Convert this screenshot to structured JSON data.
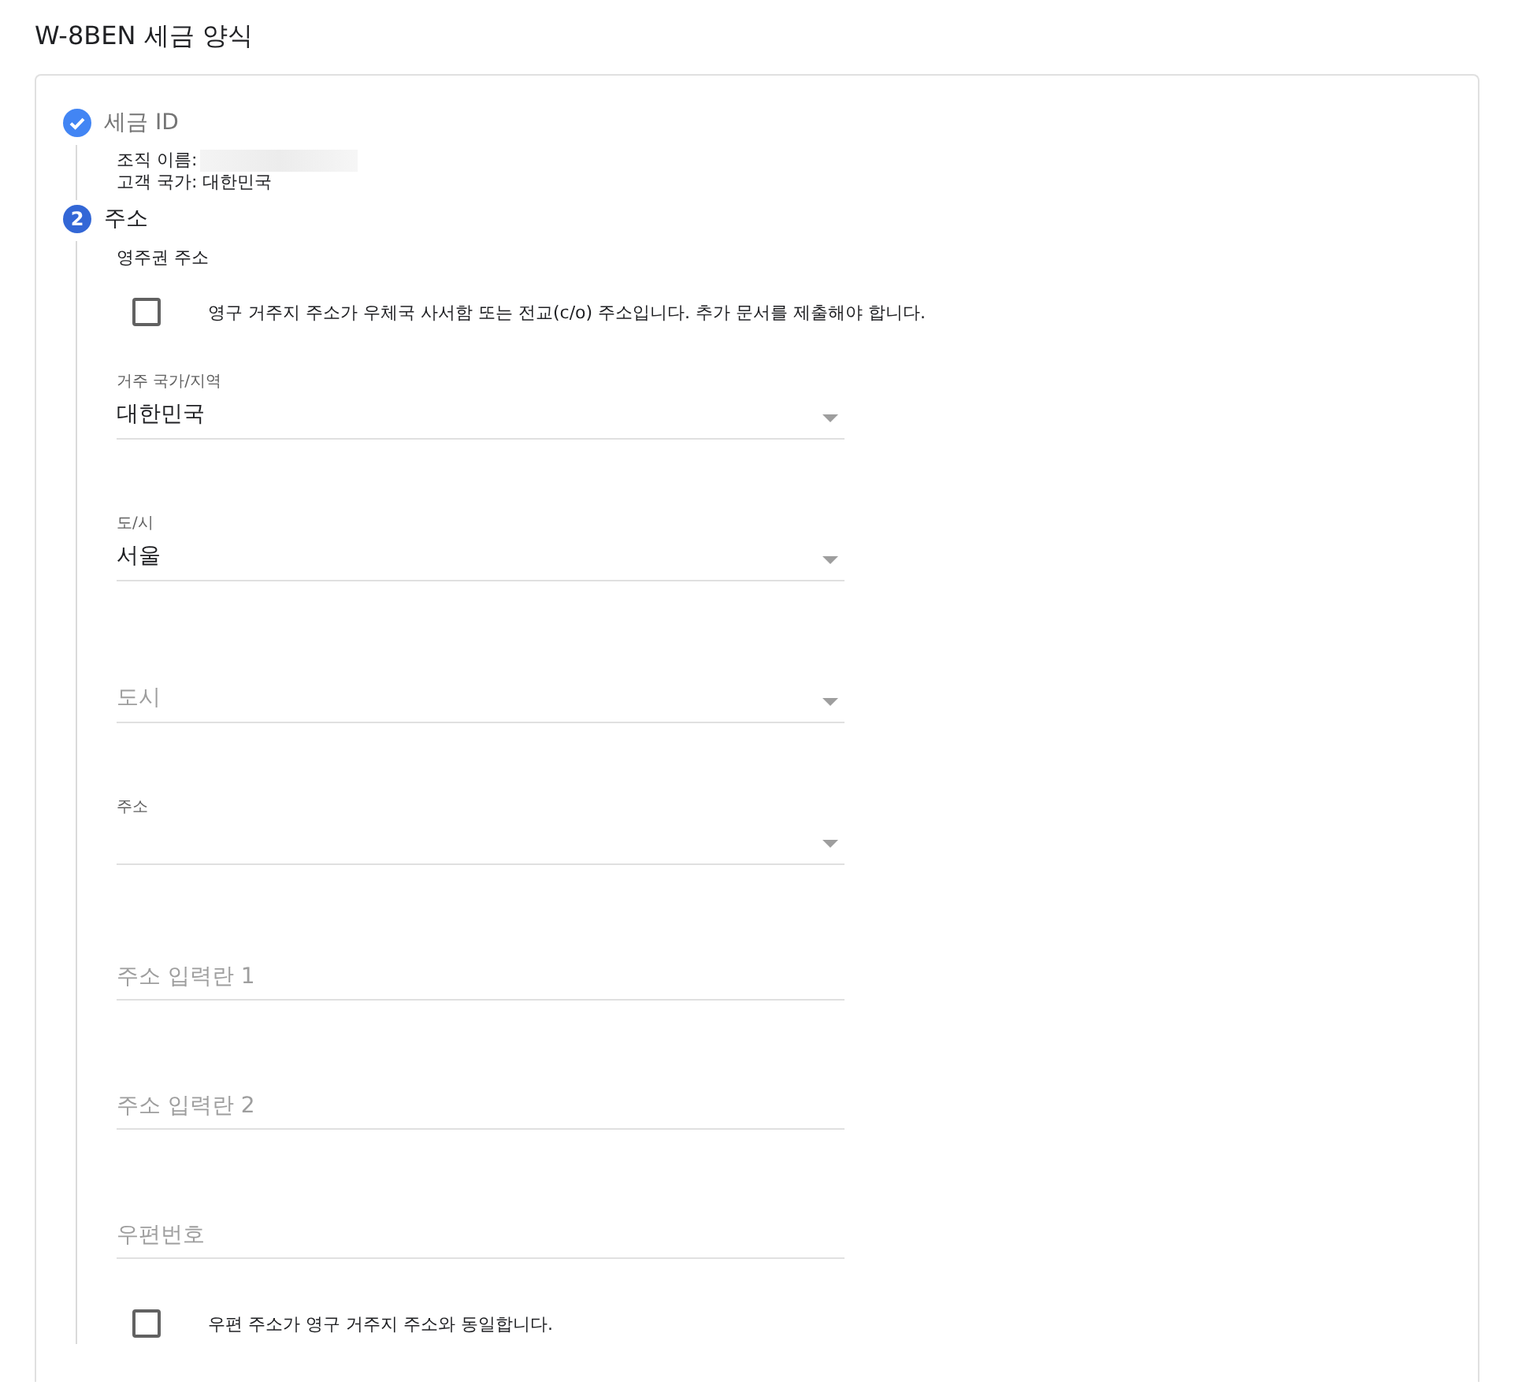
{
  "page_title": "W-8BEN 세금 양식",
  "steps": [
    {
      "completed": true,
      "title": "세금 ID",
      "lines": [
        {
          "text": "조직 이름:",
          "redacted": true
        },
        {
          "text": "고객 국가: 대한민국",
          "redacted": false
        }
      ]
    },
    {
      "completed": false,
      "number": "2",
      "title": "주소",
      "subtitle": "영주권 주소",
      "items": [
        {
          "kind": "checkbox",
          "label": "영구 거주지 주소가 우체국 사서함 또는 전교(c/o) 주소입니다. 추가 문서를 제출해야 합니다.",
          "checked": false
        },
        {
          "kind": "select",
          "label": "거주 국가/지역",
          "value": "대한민국"
        },
        {
          "kind": "select",
          "label": "도/시",
          "value": "서울"
        },
        {
          "kind": "select",
          "placeholder": "도시"
        },
        {
          "kind": "select",
          "label": "주소"
        },
        {
          "kind": "text",
          "placeholder": "주소 입력란 1"
        },
        {
          "kind": "text",
          "placeholder": "주소 입력란 2"
        },
        {
          "kind": "text",
          "placeholder": "우편번호"
        },
        {
          "kind": "checkbox",
          "label": "우편 주소가 영구 거주지 주소와 동일합니다.",
          "checked": false
        }
      ]
    }
  ]
}
